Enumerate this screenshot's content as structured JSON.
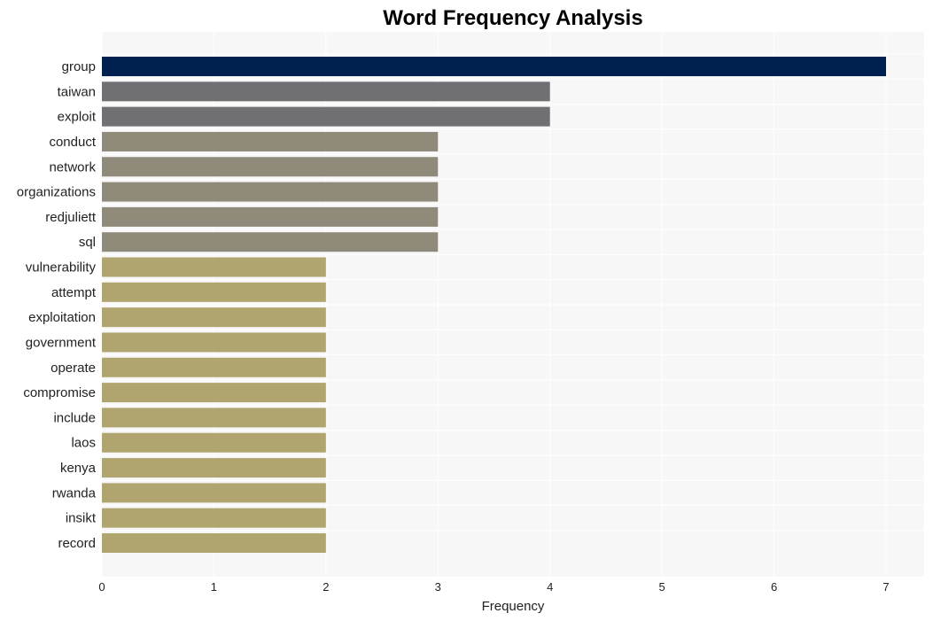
{
  "chart_data": {
    "type": "bar",
    "orientation": "horizontal",
    "title": "Word Frequency Analysis",
    "xlabel": "Frequency",
    "ylabel": "",
    "xlim": [
      0,
      7.35
    ],
    "xticks": [
      0,
      1,
      2,
      3,
      4,
      5,
      6,
      7
    ],
    "grid": true,
    "categories": [
      "group",
      "taiwan",
      "exploit",
      "conduct",
      "network",
      "organizations",
      "redjuliett",
      "sql",
      "vulnerability",
      "attempt",
      "exploitation",
      "government",
      "operate",
      "compromise",
      "include",
      "laos",
      "kenya",
      "rwanda",
      "insikt",
      "record"
    ],
    "values": [
      7,
      4,
      4,
      3,
      3,
      3,
      3,
      3,
      2,
      2,
      2,
      2,
      2,
      2,
      2,
      2,
      2,
      2,
      2,
      2
    ],
    "colors": {
      "7": "#00204f",
      "4": "#6f6f74",
      "3": "#8f8a7a",
      "2": "#b1a56f"
    },
    "background": "#f7f7f7",
    "gridline_color": "#ffffff"
  }
}
